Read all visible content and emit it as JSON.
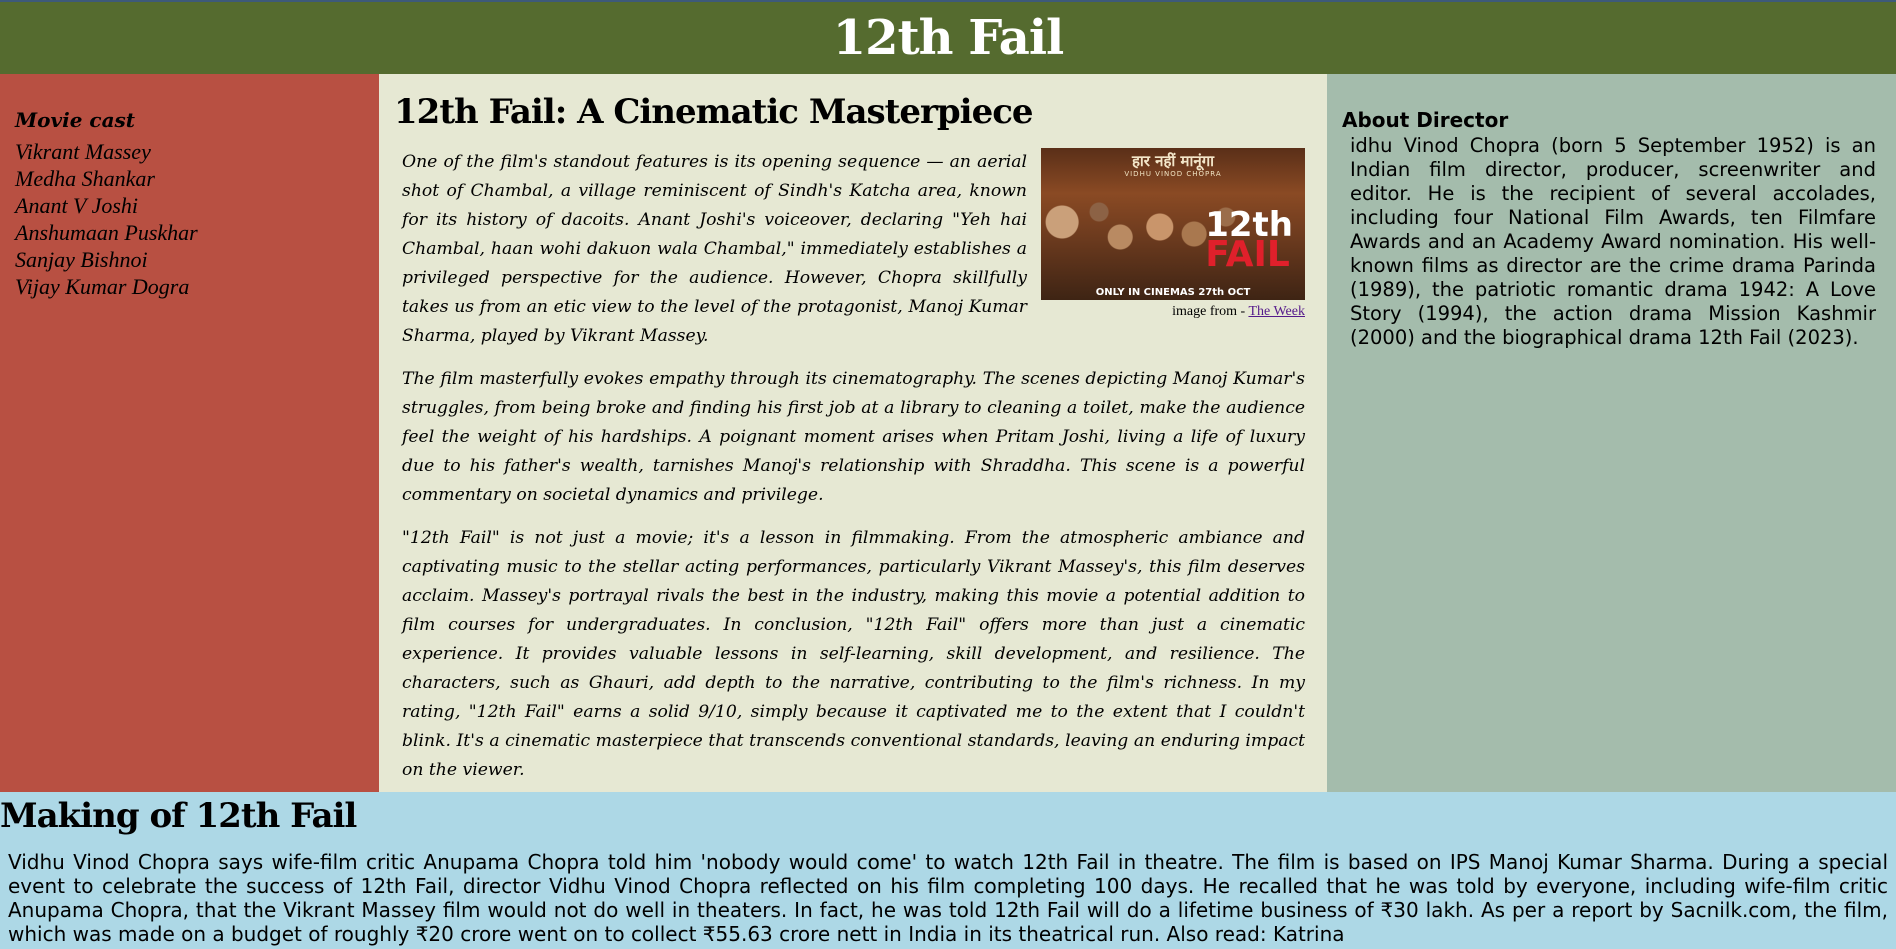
{
  "header": {
    "title": "12th Fail"
  },
  "cast": {
    "heading": "Movie cast",
    "members": [
      "Vikrant Massey",
      "Medha Shankar",
      "Anant V Joshi",
      "Anshumaan Puskhar",
      "Sanjay Bishnoi",
      "Vijay Kumar Dogra"
    ]
  },
  "review": {
    "heading": "12th Fail: A Cinematic Masterpiece",
    "poster": {
      "top_text": "हार नहीं मानूंगा",
      "sub_text": "VIDHU VINOD CHOPRA",
      "title_line1": "12th",
      "title_line2": "FAIL",
      "bottom_text": "ONLY IN CINEMAS 27th OCT"
    },
    "caption_prefix": "image from - ",
    "caption_link": "The Week",
    "paragraphs": [
      "One of the film's standout features is its opening sequence — an aerial shot of Chambal, a village reminiscent of Sindh's Katcha area, known for its history of dacoits. Anant Joshi's voiceover, declaring \"Yeh hai Chambal, haan wohi dakuon wala Chambal,\" immediately establishes a privileged perspective for the audience. However, Chopra skillfully takes us from an etic view to the level of the protagonist, Manoj Kumar Sharma, played by Vikrant Massey.",
      "The film masterfully evokes empathy through its cinematography. The scenes depicting Manoj Kumar's struggles, from being broke and finding his first job at a library to cleaning a toilet, make the audience feel the weight of his hardships. A poignant moment arises when Pritam Joshi, living a life of luxury due to his father's wealth, tarnishes Manoj's relationship with Shraddha. This scene is a powerful commentary on societal dynamics and privilege.",
      "\"12th Fail\" is not just a movie; it's a lesson in filmmaking. From the atmospheric ambiance and captivating music to the stellar acting performances, particularly Vikrant Massey's, this film deserves acclaim. Massey's portrayal rivals the best in the industry, making this movie a potential addition to film courses for undergraduates. In conclusion, \"12th Fail\" offers more than just a cinematic experience. It provides valuable lessons in self-learning, skill development, and resilience. The characters, such as Ghauri, add depth to the narrative, contributing to the film's richness. In my rating, \"12th Fail\" earns a solid 9/10, simply because it captivated me to the extent that I couldn't blink. It's a cinematic masterpiece that transcends conventional standards, leaving an enduring impact on the viewer."
    ]
  },
  "director": {
    "heading": "About Director",
    "text": "idhu Vinod Chopra (born 5 September 1952) is an Indian film director, producer, screenwriter and editor. He is the recipient of several accolades, including four National Film Awards, ten Filmfare Awards and an Academy Award nomination. His well-known films as director are the crime drama Parinda (1989), the patriotic romantic drama 1942: A Love Story (1994), the action drama Mission Kashmir (2000) and the biographical drama 12th Fail (2023)."
  },
  "making": {
    "heading": "Making of 12th Fail",
    "text": "Vidhu Vinod Chopra says wife-film critic Anupama Chopra told him 'nobody would come' to watch 12th Fail in theatre. The film is based on IPS Manoj Kumar Sharma. During a special event to celebrate the success of 12th Fail, director Vidhu Vinod Chopra reflected on his film completing 100 days. He recalled that he was told by everyone, including wife-film critic Anupama Chopra, that the Vikrant Massey film would not do well in theaters. In fact, he was told 12th Fail will do a lifetime business of ₹30 lakh. As per a report by Sacnilk.com, the film, which was made on a budget of roughly ₹20 crore went on to collect ₹55.63 crore nett in India in its theatrical run. Also read: Katrina"
  },
  "colors": {
    "header_bg": "#556b2f",
    "cast_bg": "#b85042",
    "review_bg": "#e6e8d3",
    "director_bg": "#a4bcac",
    "making_bg": "#add8e6"
  }
}
